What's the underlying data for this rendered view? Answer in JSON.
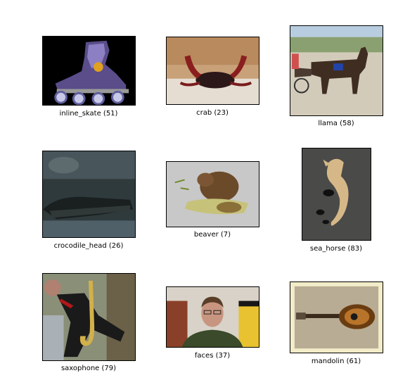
{
  "grid": {
    "items": [
      {
        "label": "inline_skate (51)",
        "image_icon": "inline-skate-photo"
      },
      {
        "label": "crab (23)",
        "image_icon": "crab-photo"
      },
      {
        "label": "llama (58)",
        "image_icon": "llama-photo"
      },
      {
        "label": "crocodile_head (26)",
        "image_icon": "crocodile-head-photo"
      },
      {
        "label": "beaver (7)",
        "image_icon": "beaver-photo"
      },
      {
        "label": "sea_horse (83)",
        "image_icon": "sea-horse-photo"
      },
      {
        "label": "saxophone (79)",
        "image_icon": "saxophone-photo"
      },
      {
        "label": "faces (37)",
        "image_icon": "face-photo"
      },
      {
        "label": "mandolin (61)",
        "image_icon": "mandolin-photo"
      }
    ]
  }
}
